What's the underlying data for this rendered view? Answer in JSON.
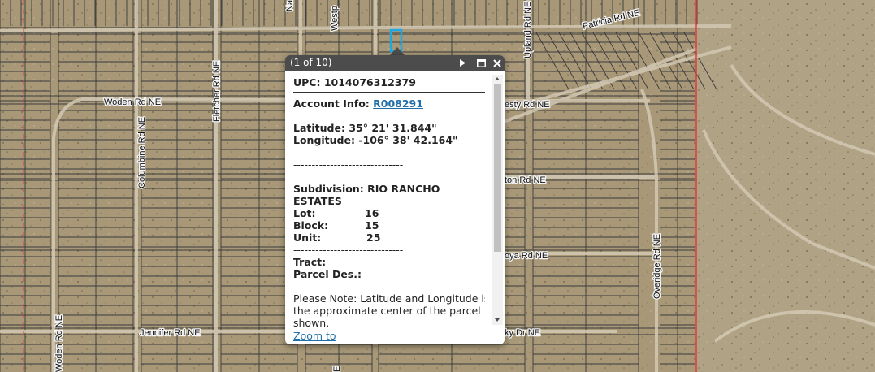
{
  "map": {
    "road_labels": {
      "woden_top": "Woden Rd NE",
      "woden_left": "Woden Rd NE",
      "fletcher": "Fletcher Rd NE",
      "columbine": "Columbine Rd NE",
      "westpt": "Westp",
      "na": "Na",
      "upland": "Upland Rd NE",
      "patricia": "Patricia Rd NE",
      "esty": "esty Rd NE",
      "ton": "ton Rd NE",
      "oya": "oya Rd NE",
      "overidge": "Overidge Rd NE",
      "jennifer": "Jennifer Rd NE",
      "ky_dr": "ky Dr NE",
      "bottom_e": "E"
    },
    "colors": {
      "terrain": "#a89878",
      "parcel_line": "#3a3a3a",
      "boundary": "#e33b3b",
      "selection": "#1ea7e1"
    }
  },
  "popup": {
    "count": "(1 of 10)",
    "icons": {
      "next": "next-icon",
      "maximize": "maximize-icon",
      "close": "close-icon"
    },
    "upc_label": "UPC:",
    "upc_value": "1014076312379",
    "account_label": "Account Info:",
    "account_value": "R008291",
    "latitude_label": "Latitude:",
    "latitude_value": "35° 21' 31.844\"",
    "longitude_label": "Longitude:",
    "longitude_value": "-106° 38' 42.164\"",
    "separator": "------------------------------",
    "subdivision_label": "Subdivision:",
    "subdivision_value_1": "RIO RANCHO",
    "subdivision_value_2": "ESTATES",
    "lot_label": "Lot:",
    "lot_value": "16",
    "block_label": "Block:",
    "block_value": "15",
    "unit_label": "Unit:",
    "unit_value": "25",
    "tract_label": "Tract:",
    "parcel_label": "Parcel Des.:",
    "note_1": "Please Note: Latitude and Longitude is",
    "note_2": "the approximate center of the parcel",
    "note_3": "shown.",
    "zoom_to": "Zoom to"
  }
}
